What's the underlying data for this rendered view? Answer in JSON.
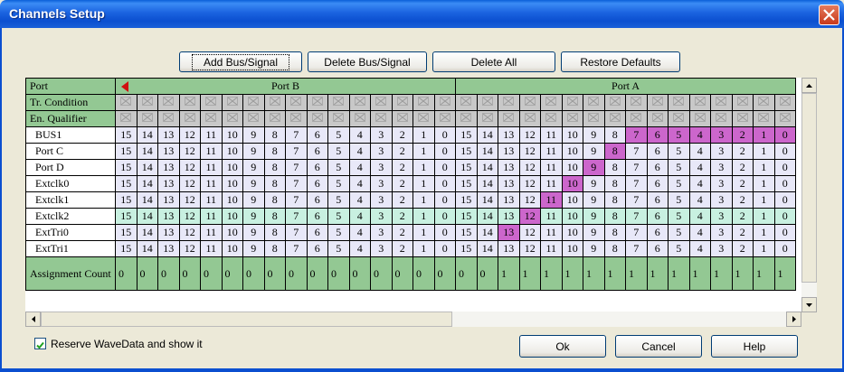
{
  "window": {
    "title": "Channels Setup"
  },
  "toolbar": {
    "add_label": "Add Bus/Signal",
    "delete_label": "Delete Bus/Signal",
    "delete_all_label": "Delete All",
    "restore_label": "Restore Defaults"
  },
  "grid": {
    "port_header": "Port",
    "port_b": "Port B",
    "port_a": "Port A",
    "tr_condition": "Tr. Condition",
    "en_qualifier": "En. Qualifier",
    "assignment_label": "Assignment Count",
    "bits_b": [
      "15",
      "14",
      "13",
      "12",
      "11",
      "10",
      "9",
      "8",
      "7",
      "6",
      "5",
      "4",
      "3",
      "2",
      "1",
      "0"
    ],
    "bits_a": [
      "15",
      "14",
      "13",
      "12",
      "11",
      "10",
      "9",
      "8",
      "7",
      "6",
      "5",
      "4",
      "3",
      "2",
      "1",
      "0"
    ],
    "rows": [
      {
        "name": "BUS1",
        "hl": [
          7,
          6,
          5,
          4,
          3,
          2,
          1,
          0
        ]
      },
      {
        "name": "Port C",
        "hl": [
          8
        ]
      },
      {
        "name": "Port D",
        "hl": [
          9
        ]
      },
      {
        "name": "Extclk0",
        "hl": [
          10
        ]
      },
      {
        "name": "Extclk1",
        "hl": [
          11
        ]
      },
      {
        "name": "Extclk2",
        "hl": [
          12
        ],
        "selected": true
      },
      {
        "name": "ExtTri0",
        "hl": [
          13
        ]
      },
      {
        "name": "ExtTri1",
        "hl": []
      }
    ],
    "counts_b": [
      "0",
      "0",
      "0",
      "0",
      "0",
      "0",
      "0",
      "0",
      "0",
      "0",
      "0",
      "0",
      "0",
      "0",
      "0",
      "0"
    ],
    "counts_a": [
      "0",
      "0",
      "1",
      "1",
      "1",
      "1",
      "1",
      "1",
      "1",
      "1",
      "1",
      "1",
      "1",
      "1",
      "1",
      "1"
    ],
    "highlight_color": "#cc66cc",
    "header_color": "#93c893"
  },
  "options": {
    "reserve_label": "Reserve WaveData and show it",
    "reserve_checked": true
  },
  "footer": {
    "ok_label": "Ok",
    "cancel_label": "Cancel",
    "help_label": "Help"
  }
}
